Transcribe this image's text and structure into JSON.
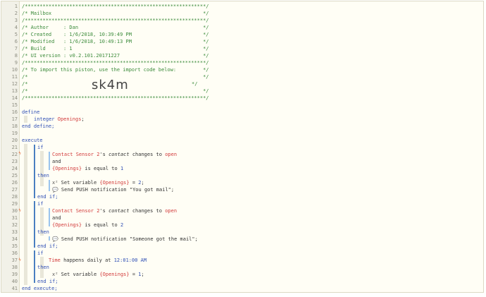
{
  "line_numbers": [
    "1",
    "2",
    "3",
    "4",
    "5",
    "6",
    "7",
    "8",
    "9",
    "10",
    "11",
    "12",
    "13",
    "14",
    "15",
    "16",
    "17",
    "18",
    "19",
    "20",
    "21",
    "22",
    "23",
    "24",
    "25",
    "26",
    "27",
    "28",
    "29",
    "30",
    "31",
    "32",
    "33",
    "34",
    "35",
    "36",
    "37",
    "38",
    "39",
    "40",
    "41"
  ],
  "markers": {
    "line22": "ϟ",
    "line30": "ϟ",
    "line37": "ϟ"
  },
  "header": {
    "l1": "/*************************************************************/",
    "l2": "/* Mailbox                                                   */",
    "l3": "/*************************************************************/",
    "l4": "/* Author     : Dan                                          */",
    "l5": "/* Created    : 1/6/2018, 10:39:49 PM                        */",
    "l6": "/* Modified   : 1/6/2018, 10:49:13 PM                        */",
    "l7": "/* Build      : 1                                            */",
    "l8": "/* UI version : v0.2.101.20171227                            */",
    "l9": "/*************************************************************/",
    "l10": "/* To import this piston, use the import code below:         */",
    "l11": "/*                                                           */",
    "l12_left": "/*",
    "l12_code": "sk4m",
    "l12_right": "*/",
    "l13": "/*                                                           */",
    "l14": "/*************************************************************/"
  },
  "define": {
    "keyword": "define",
    "type": "integer",
    "var": "Openings",
    "semi": ";",
    "end": "end define;"
  },
  "execute": {
    "keyword": "execute",
    "end": "end execute;",
    "if": "if",
    "and": "and",
    "then": "then",
    "end_if": "end if;",
    "block1": {
      "device": "Contact Sensor 2",
      "possessive": "'s ",
      "attr": "contact",
      "changes": " changes to ",
      "value": "open",
      "var": "{Openings}",
      "is_equal": " is equal to ",
      "num": "1",
      "set_icon": "x²",
      "set_text": " Set variable ",
      "set_var": "{Openings}",
      "set_eq": " = ",
      "set_val": "2",
      "set_semi": ";",
      "push_icon": "💬",
      "push_text": " Send PUSH notification ",
      "push_msg": "\"You got mail\"",
      "push_semi": ";"
    },
    "block2": {
      "device": "Contact Sensor 2",
      "possessive": "'s ",
      "attr": "contact",
      "changes": " changes to ",
      "value": "open",
      "var": "{Openings}",
      "is_equal": " is equal to ",
      "num": "2",
      "push_icon": "💬",
      "push_text": " Send PUSH notification ",
      "push_msg": "\"Someone got the mail\"",
      "push_semi": ";"
    },
    "block3": {
      "time": "Time",
      "happens": " happens daily at ",
      "at_time": "12:01:00 AM",
      "set_icon": "x²",
      "set_text": " Set variable ",
      "set_var": "{Openings}",
      "set_eq": " = ",
      "set_val": "1",
      "set_semi": ";"
    }
  }
}
